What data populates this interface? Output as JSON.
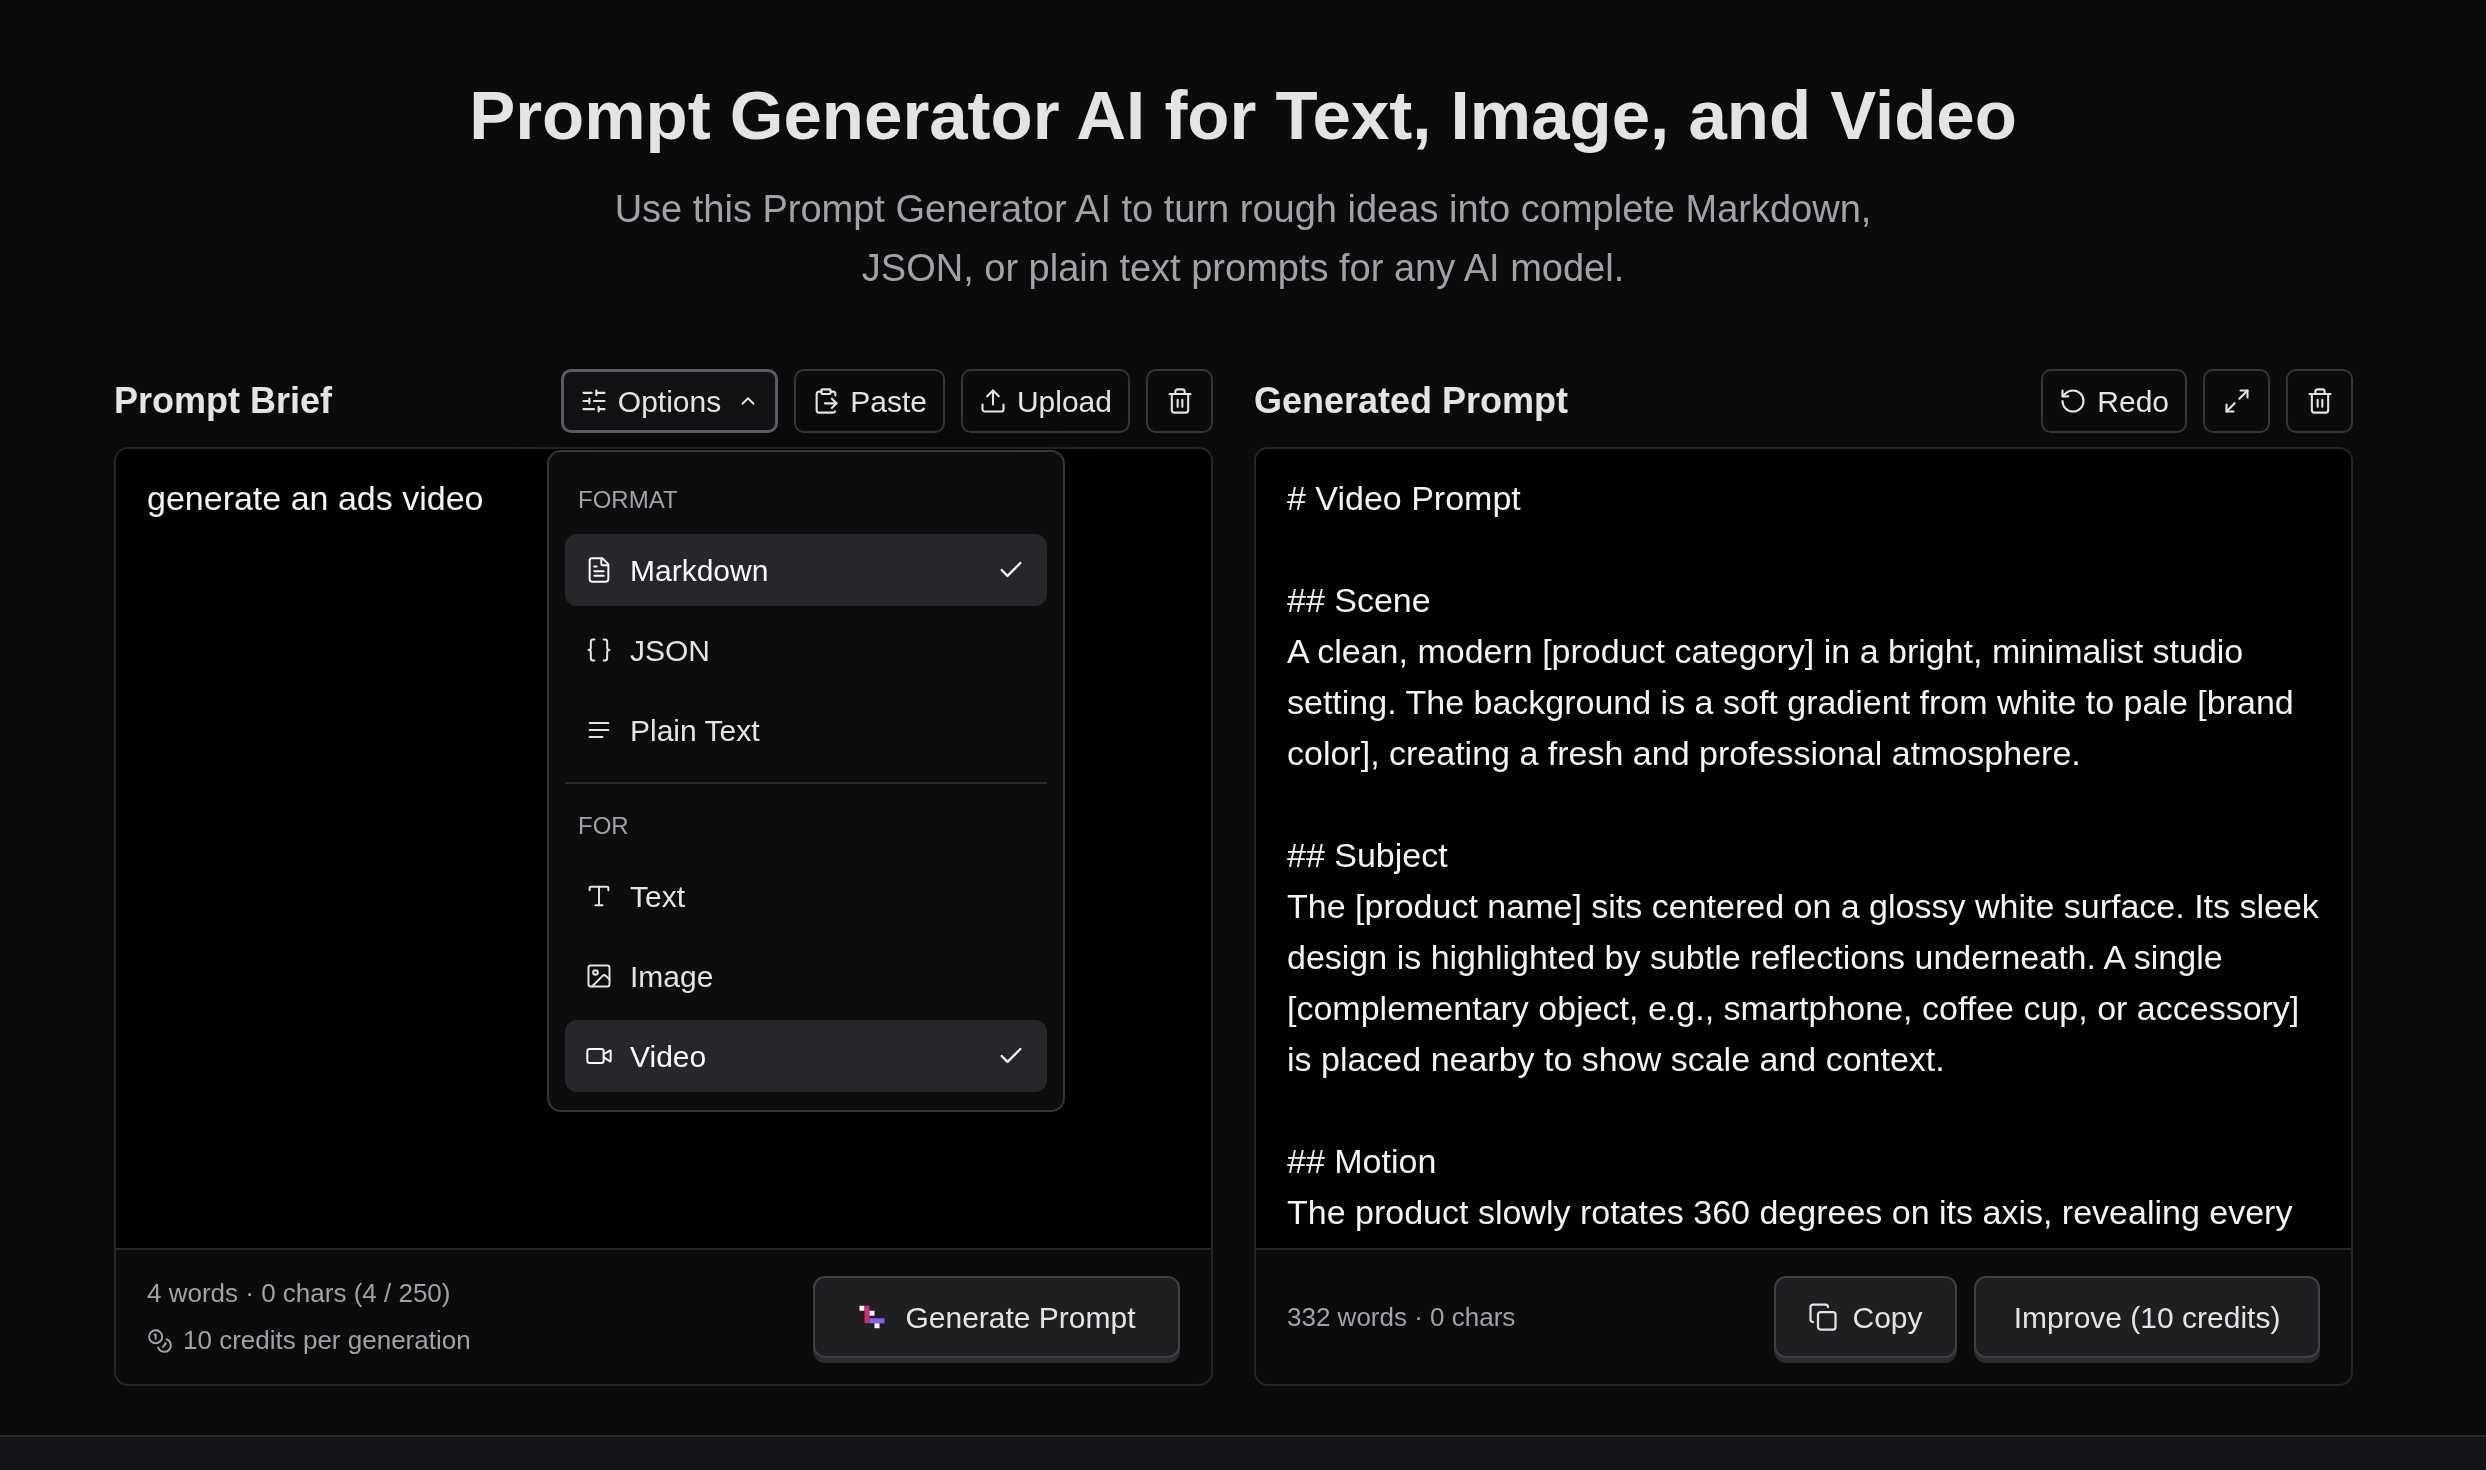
{
  "header": {
    "title": "Prompt Generator AI for Text, Image, and Video",
    "subtitle": "Use this Prompt Generator AI to turn rough ideas into complete Markdown, JSON, or plain text prompts for any AI model."
  },
  "brief_panel": {
    "title": "Prompt Brief",
    "toolbar": [
      {
        "kind": "options",
        "label": "Options",
        "expanded": true
      },
      {
        "kind": "paste",
        "label": "Paste"
      },
      {
        "kind": "upload",
        "label": "Upload"
      },
      {
        "kind": "delete"
      }
    ],
    "input_value": "generate an ads video",
    "stats": "4 words · 0 chars (4 / 250)",
    "credits_note": "10 credits per generation",
    "generate_button": "Generate Prompt"
  },
  "options_menu": {
    "groups": [
      {
        "heading": "FORMAT",
        "items": [
          {
            "kind": "markdown",
            "label": "Markdown",
            "selected": true
          },
          {
            "kind": "json",
            "label": "JSON",
            "selected": false
          },
          {
            "kind": "plain",
            "label": "Plain Text",
            "selected": false
          }
        ]
      },
      {
        "heading": "FOR",
        "items": [
          {
            "kind": "text",
            "label": "Text",
            "selected": false
          },
          {
            "kind": "image",
            "label": "Image",
            "selected": false
          },
          {
            "kind": "video",
            "label": "Video",
            "selected": true
          }
        ]
      }
    ]
  },
  "output_panel": {
    "title": "Generated Prompt",
    "toolbar": [
      {
        "kind": "redo",
        "label": "Redo"
      },
      {
        "kind": "expand"
      },
      {
        "kind": "delete"
      }
    ],
    "content": {
      "heading": "# Video Prompt",
      "sections": [
        {
          "heading": "## Scene",
          "text": "A clean, modern [product category] in a bright, minimalist studio setting. The background is a soft gradient from white to pale [brand color], creating a fresh and professional atmosphere."
        },
        {
          "heading": "## Subject",
          "text": "The [product name] sits centered on a glossy white surface. Its sleek design is highlighted by subtle reflections underneath. A single [complementary object, e.g., smartphone, coffee cup, or accessory] is placed nearby to show scale and context."
        },
        {
          "heading": "## Motion",
          "text": "The product slowly rotates 360 degrees on its axis, revealing every"
        }
      ]
    },
    "stats": "332 words · 0 chars",
    "buttons": [
      {
        "kind": "copy",
        "label": "Copy"
      },
      {
        "kind": "improve",
        "label": "Improve (10 credits)"
      }
    ]
  }
}
